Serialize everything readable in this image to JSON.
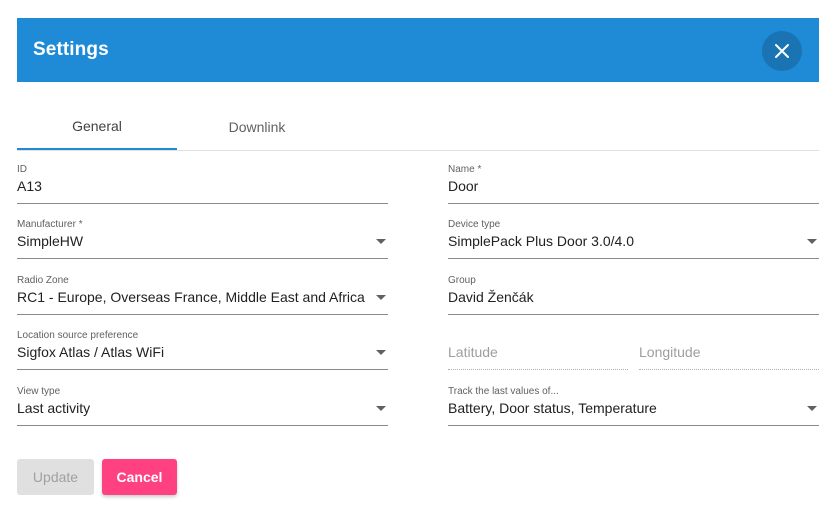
{
  "dialog": {
    "title": "Settings",
    "close_icon": "close-icon"
  },
  "tabs": [
    {
      "label": "General",
      "active": true
    },
    {
      "label": "Downlink",
      "active": false
    }
  ],
  "fields": {
    "id": {
      "label": "ID",
      "value": "A13"
    },
    "name": {
      "label": "Name *",
      "value": "Door"
    },
    "manufacturer": {
      "label": "Manufacturer *",
      "value": "SimpleHW"
    },
    "device_type": {
      "label": "Device type",
      "value": "SimplePack Plus Door 3.0/4.0"
    },
    "radio_zone": {
      "label": "Radio Zone",
      "value": "RC1 - Europe, Overseas France, Middle East and Africa"
    },
    "group": {
      "label": "Group",
      "value": "David Ženčák"
    },
    "location_source": {
      "label": "Location source preference",
      "value": "Sigfox Atlas / Atlas WiFi"
    },
    "latitude": {
      "placeholder": "Latitude"
    },
    "longitude": {
      "placeholder": "Longitude"
    },
    "view_type": {
      "label": "View type",
      "value": "Last activity"
    },
    "track_values": {
      "label": "Track the last values of...",
      "value": "Battery, Door status, Temperature"
    }
  },
  "actions": {
    "update_label": "Update",
    "cancel_label": "Cancel"
  },
  "colors": {
    "header": "#1f8bd6",
    "close_button": "#1a73b3",
    "cancel_button": "#ff4081",
    "update_button_disabled": "#e0e0e0"
  }
}
